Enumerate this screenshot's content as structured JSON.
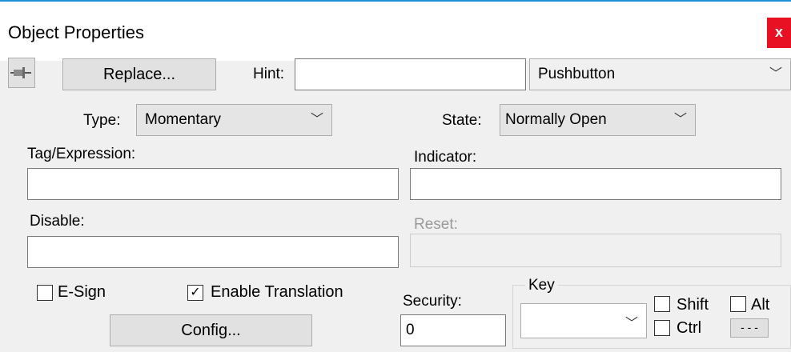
{
  "window": {
    "title": "Object Properties",
    "close_glyph": "x"
  },
  "toolbar": {
    "pin_icon": "pushpin-icon",
    "replace_label": "Replace...",
    "hint_label": "Hint:",
    "hint_value": "",
    "object_type": "Pushbutton"
  },
  "type": {
    "label": "Type:",
    "value": "Momentary"
  },
  "state": {
    "label": "State:",
    "value": "Normally Open"
  },
  "tag": {
    "label": "Tag/Expression:",
    "value": ""
  },
  "indicator": {
    "label": "Indicator:",
    "value": ""
  },
  "disable": {
    "label": "Disable:",
    "value": ""
  },
  "reset": {
    "label": "Reset:",
    "value": ""
  },
  "esign": {
    "label": "E-Sign",
    "checked": false
  },
  "translation": {
    "label": "Enable Translation",
    "checked": true
  },
  "config_label": "Config...",
  "security": {
    "label": "Security:",
    "value": "0"
  },
  "key": {
    "group_label": "Key",
    "value": "",
    "shift_label": "Shift",
    "shift_checked": false,
    "alt_label": "Alt",
    "alt_checked": false,
    "ctrl_label": "Ctrl",
    "ctrl_checked": false,
    "more_label": "- - -"
  },
  "chevron_glyph": "﹀",
  "check_glyph": "✓"
}
